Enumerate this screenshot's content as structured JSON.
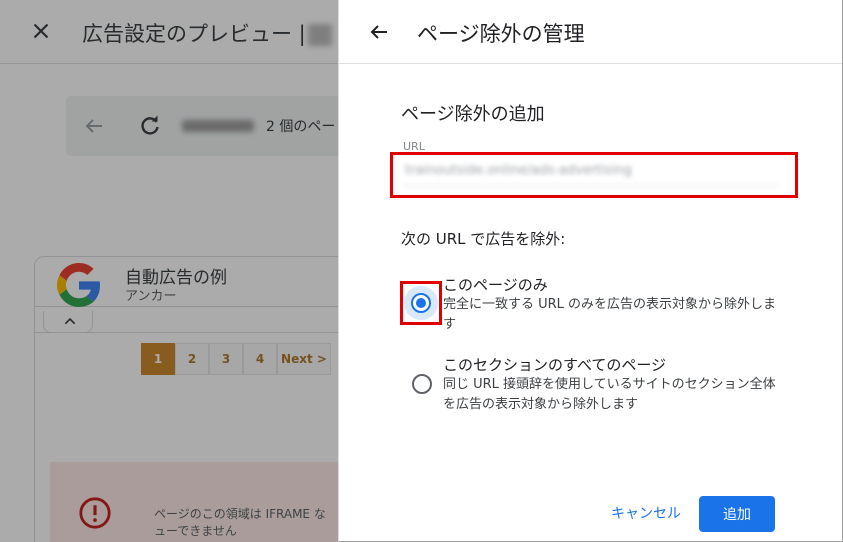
{
  "background": {
    "title": "広告設定のプレビュー |",
    "page_count": "2 個のペー",
    "card": {
      "title": "自動広告の例",
      "subtitle": "アンカー"
    },
    "pagination": [
      "1",
      "2",
      "3",
      "4",
      "Next >"
    ],
    "error_lines": [
      "ページのこの領域は IFRAME な",
      "ューできません"
    ]
  },
  "panel": {
    "title": "ページ除外の管理",
    "section_title": "ページ除外の追加",
    "url_label": "URL",
    "url_value": "trainoutside.online/ads-advertising",
    "exclude_label": "次の URL で広告を除外:",
    "options": [
      {
        "title": "このページのみ",
        "description": "完全に一致する URL のみを広告の表示対象から除外します",
        "selected": true
      },
      {
        "title": "このセクションのすべてのページ",
        "description": "同じ URL 接頭辞を使用しているサイトのセクション全体を広告の表示対象から除外します",
        "selected": false
      }
    ],
    "cancel_label": "キャンセル",
    "add_label": "追加"
  },
  "colors": {
    "accent": "#1a73e8",
    "highlight": "#e00000",
    "pagination_active": "#c98a2e",
    "error_bg": "#fde9e7"
  },
  "icons": {
    "close": "close-icon",
    "back": "arrow-left-icon",
    "reload": "reload-icon",
    "google": "google-logo",
    "caret": "chevron-up-icon",
    "error": "error-circle-icon"
  }
}
